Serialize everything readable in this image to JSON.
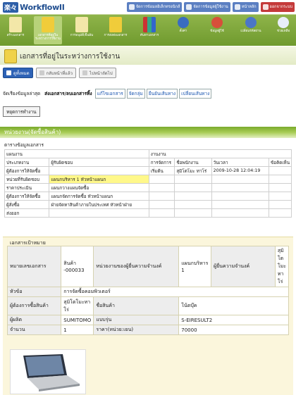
{
  "header": {
    "logo_kanji": "楽々",
    "logo_text": "WorkflowII",
    "links": [
      {
        "label": "จัดการข้อมลอิเล็กทรอนิกส์"
      },
      {
        "label": "จัดการข้อมูลผู้ใช้งาน"
      },
      {
        "label": "หน้าหลัก"
      },
      {
        "label": "ออกจากระบบ"
      }
    ]
  },
  "nav": [
    {
      "label": "สร้างเอกสาร"
    },
    {
      "label": "เอกสารที่อยู่ในระหว่างการใช้งาน"
    },
    {
      "label": "การอนุมัติ/ยืนยัน"
    },
    {
      "label": "การส่งต่อเอกสาร"
    },
    {
      "label": "ค้นหาเอกสาร"
    },
    {
      "label": "ตั้งค่า"
    },
    {
      "label": "ข้อมูลผู้ใช้"
    },
    {
      "label": "เปลี่ยนรหัสผ่าน"
    },
    {
      "label": "ช่วยเหลือ"
    }
  ],
  "title": "เอกสารที่อยู่ในระหว่างการใช้งาน",
  "buttons": {
    "pre": "ดูทั้งหมด",
    "prev": "กลับหน้าที่แล้ว",
    "next": "ไปหน้าถัดไป"
  },
  "tabs": {
    "label": "จัดเรียงข้อมูลล่าสุด",
    "items": [
      "ส่งเอกสาร/ลบเอกสารทิ้ง",
      "แก้ไขเอกสาร",
      "จัดกลุ่ม",
      "ยืนยันเส้นทาง",
      "เปลี่ยนเส้นทาง"
    ]
  },
  "stop_label": "หยุดการทำงาน",
  "section_title": "หน่วยงาน(จัดซื้อสินค้า)",
  "info_title": "ตารางข้อมูลเอกสาร",
  "flow": {
    "headers": [
      "แผนงาน",
      "",
      "งานงาน"
    ],
    "cols": [
      "ประเภทงาน",
      "ผู้รับผิดชอบ",
      "การจัดการ",
      "ชื่อพนักงาน",
      "วันเวลา",
      "ข้อคิดเห็น"
    ],
    "rows": [
      [
        "ผู้ต้องการให้จัดซื้อ",
        "",
        "เริ่มต้น",
        "สุมิโตโมะ ทาโร่",
        "2009-10-28 12:04:19",
        ""
      ],
      [
        "หน่วยที่รับผิดชอบ",
        "แผนกบริหาร 1 หัวหน้าแผนก",
        "",
        "",
        "",
        ""
      ],
      [
        "ราคาประเมิน",
        "แผนกวางแผนจัดซื้อ",
        "",
        "",
        "",
        ""
      ],
      [
        "ผู้ต้องการให้จัดซื้อ",
        "แผนกจัดการจัดซื้อ หัวหน้าแผนก",
        "",
        "",
        "",
        ""
      ],
      [
        "ผู้สั่งซื้อ",
        "ฝ่ายจัดหาสินค้าภายในประเทศ หัวหน้าฝ่าย",
        "",
        "",
        "",
        ""
      ],
      [
        "ส่งออก",
        "",
        "",
        "",
        "",
        ""
      ]
    ]
  },
  "target": {
    "title": "เอกสารเป้าหมาย",
    "doc_no_label": "หมายเลขเอกสาร",
    "doc_no": "สินค้า -000033",
    "dept_label": "หน่วยงานของผู้ยื่นความจำนงค์",
    "dept": "แผนกบริหาร 1",
    "applicant_label": "ผู้ยื่นความจำนงค์",
    "applicant": "สุมิโตโมะทาโร่",
    "subject_label": "หัวข้อ",
    "subject": "การจัดซื้อคอมพิวเตอร์",
    "requester_label": "ผู้ต้องการซื้อสินค้า",
    "requester": "สุมิโตโมะทาโร่",
    "product_label": "ชื่อสินค้า",
    "product": "โน้ตบุ๊ค",
    "maker_label": "ผู้ผลิต",
    "maker": "SUMITOMO",
    "model_label": "แบบรุ่น",
    "model": "S-EIRESULT2",
    "qty_label": "จำนวน",
    "qty": "1",
    "price_label": "ราคา(หน่วย:เยน)",
    "price": "70000"
  }
}
